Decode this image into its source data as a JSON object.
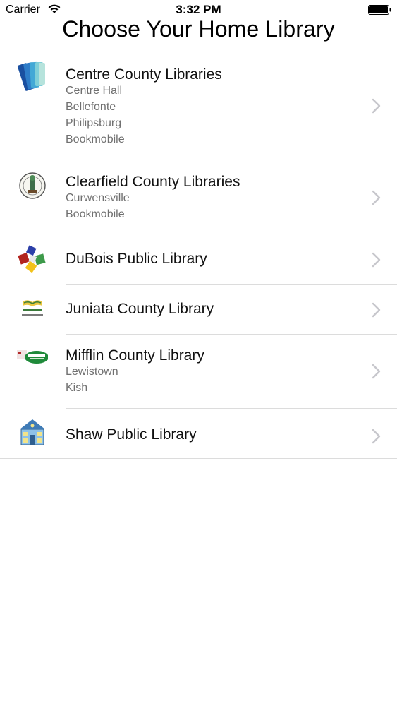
{
  "status_bar": {
    "carrier": "Carrier",
    "time": "3:32 PM",
    "wifi_icon": "wifi-icon",
    "battery_icon": "battery-icon"
  },
  "header": {
    "title": "Choose Your Home Library"
  },
  "libraries": [
    {
      "name": "Centre County Libraries",
      "logo_icon": "books-logo-icon",
      "branches": [
        "Centre Hall",
        "Bellefonte",
        "Philipsburg",
        "Bookmobile"
      ]
    },
    {
      "name": "Clearfield County Libraries",
      "logo_icon": "seal-logo-icon",
      "branches": [
        "Curwensville",
        "Bookmobile"
      ]
    },
    {
      "name": "DuBois Public Library",
      "logo_icon": "color-blocks-logo-icon",
      "branches": []
    },
    {
      "name": "Juniata County Library",
      "logo_icon": "open-book-logo-icon",
      "branches": []
    },
    {
      "name": "Mifflin County Library",
      "logo_icon": "mifflin-logo-icon",
      "branches": [
        "Lewistown",
        "Kish"
      ]
    },
    {
      "name": "Shaw Public Library",
      "logo_icon": "building-logo-icon",
      "branches": []
    }
  ],
  "colors": {
    "chevron": "#c7c7cc",
    "divider": "#dcdcdc",
    "subtitle": "#707070"
  }
}
